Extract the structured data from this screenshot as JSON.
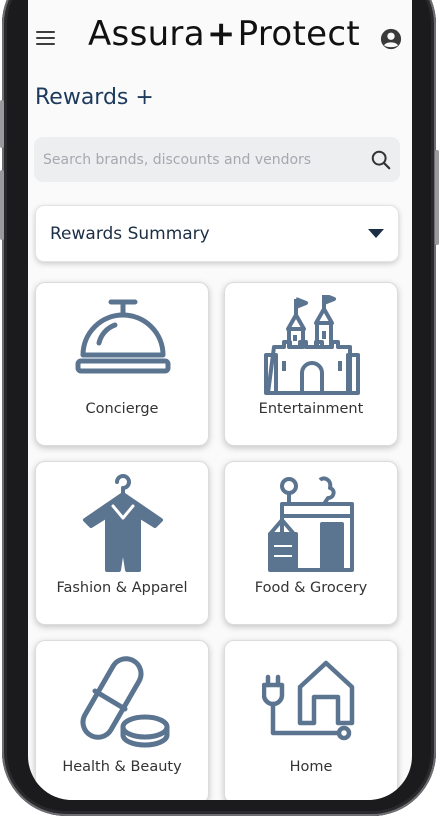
{
  "header": {
    "brand_left": "Assura",
    "brand_plus": "+",
    "brand_right": "Protect",
    "menu_icon": "hamburger-menu-icon",
    "user_icon": "user-account-icon"
  },
  "page": {
    "title": "Rewards +"
  },
  "search": {
    "placeholder": "Search brands, discounts and vendors",
    "value": "",
    "icon": "search-icon"
  },
  "dropdown": {
    "selected": "Rewards Summary",
    "icon": "caret-down-icon"
  },
  "categories": [
    {
      "label": "Concierge",
      "icon": "service-bell-icon"
    },
    {
      "label": "Entertainment",
      "icon": "castle-icon"
    },
    {
      "label": "Fashion & Apparel",
      "icon": "garment-on-hanger-icon"
    },
    {
      "label": "Food & Grocery",
      "icon": "grocery-bag-icon"
    },
    {
      "label": "Health & Beauty",
      "icon": "pills-icon"
    },
    {
      "label": "Home",
      "icon": "house-plug-icon"
    }
  ],
  "colors": {
    "icon": "#5b7490",
    "title": "#1d3a5c",
    "search_bg": "#eceef0",
    "frame": "#1b1b1d"
  }
}
